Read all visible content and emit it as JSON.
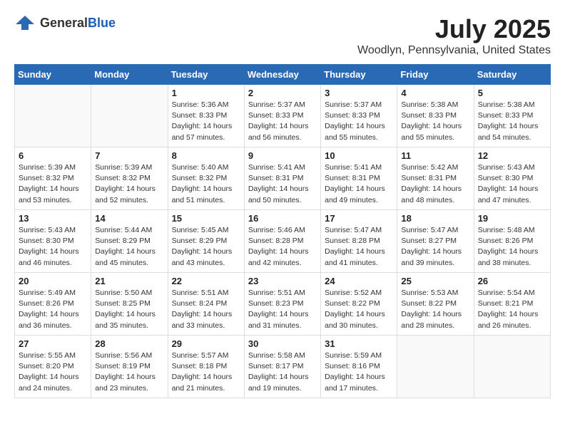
{
  "header": {
    "logo_general": "General",
    "logo_blue": "Blue",
    "month_year": "July 2025",
    "location": "Woodlyn, Pennsylvania, United States"
  },
  "days_of_week": [
    "Sunday",
    "Monday",
    "Tuesday",
    "Wednesday",
    "Thursday",
    "Friday",
    "Saturday"
  ],
  "weeks": [
    [
      {
        "day": "",
        "sunrise": "",
        "sunset": "",
        "daylight": ""
      },
      {
        "day": "",
        "sunrise": "",
        "sunset": "",
        "daylight": ""
      },
      {
        "day": "1",
        "sunrise": "Sunrise: 5:36 AM",
        "sunset": "Sunset: 8:33 PM",
        "daylight": "Daylight: 14 hours and 57 minutes."
      },
      {
        "day": "2",
        "sunrise": "Sunrise: 5:37 AM",
        "sunset": "Sunset: 8:33 PM",
        "daylight": "Daylight: 14 hours and 56 minutes."
      },
      {
        "day": "3",
        "sunrise": "Sunrise: 5:37 AM",
        "sunset": "Sunset: 8:33 PM",
        "daylight": "Daylight: 14 hours and 55 minutes."
      },
      {
        "day": "4",
        "sunrise": "Sunrise: 5:38 AM",
        "sunset": "Sunset: 8:33 PM",
        "daylight": "Daylight: 14 hours and 55 minutes."
      },
      {
        "day": "5",
        "sunrise": "Sunrise: 5:38 AM",
        "sunset": "Sunset: 8:33 PM",
        "daylight": "Daylight: 14 hours and 54 minutes."
      }
    ],
    [
      {
        "day": "6",
        "sunrise": "Sunrise: 5:39 AM",
        "sunset": "Sunset: 8:32 PM",
        "daylight": "Daylight: 14 hours and 53 minutes."
      },
      {
        "day": "7",
        "sunrise": "Sunrise: 5:39 AM",
        "sunset": "Sunset: 8:32 PM",
        "daylight": "Daylight: 14 hours and 52 minutes."
      },
      {
        "day": "8",
        "sunrise": "Sunrise: 5:40 AM",
        "sunset": "Sunset: 8:32 PM",
        "daylight": "Daylight: 14 hours and 51 minutes."
      },
      {
        "day": "9",
        "sunrise": "Sunrise: 5:41 AM",
        "sunset": "Sunset: 8:31 PM",
        "daylight": "Daylight: 14 hours and 50 minutes."
      },
      {
        "day": "10",
        "sunrise": "Sunrise: 5:41 AM",
        "sunset": "Sunset: 8:31 PM",
        "daylight": "Daylight: 14 hours and 49 minutes."
      },
      {
        "day": "11",
        "sunrise": "Sunrise: 5:42 AM",
        "sunset": "Sunset: 8:31 PM",
        "daylight": "Daylight: 14 hours and 48 minutes."
      },
      {
        "day": "12",
        "sunrise": "Sunrise: 5:43 AM",
        "sunset": "Sunset: 8:30 PM",
        "daylight": "Daylight: 14 hours and 47 minutes."
      }
    ],
    [
      {
        "day": "13",
        "sunrise": "Sunrise: 5:43 AM",
        "sunset": "Sunset: 8:30 PM",
        "daylight": "Daylight: 14 hours and 46 minutes."
      },
      {
        "day": "14",
        "sunrise": "Sunrise: 5:44 AM",
        "sunset": "Sunset: 8:29 PM",
        "daylight": "Daylight: 14 hours and 45 minutes."
      },
      {
        "day": "15",
        "sunrise": "Sunrise: 5:45 AM",
        "sunset": "Sunset: 8:29 PM",
        "daylight": "Daylight: 14 hours and 43 minutes."
      },
      {
        "day": "16",
        "sunrise": "Sunrise: 5:46 AM",
        "sunset": "Sunset: 8:28 PM",
        "daylight": "Daylight: 14 hours and 42 minutes."
      },
      {
        "day": "17",
        "sunrise": "Sunrise: 5:47 AM",
        "sunset": "Sunset: 8:28 PM",
        "daylight": "Daylight: 14 hours and 41 minutes."
      },
      {
        "day": "18",
        "sunrise": "Sunrise: 5:47 AM",
        "sunset": "Sunset: 8:27 PM",
        "daylight": "Daylight: 14 hours and 39 minutes."
      },
      {
        "day": "19",
        "sunrise": "Sunrise: 5:48 AM",
        "sunset": "Sunset: 8:26 PM",
        "daylight": "Daylight: 14 hours and 38 minutes."
      }
    ],
    [
      {
        "day": "20",
        "sunrise": "Sunrise: 5:49 AM",
        "sunset": "Sunset: 8:26 PM",
        "daylight": "Daylight: 14 hours and 36 minutes."
      },
      {
        "day": "21",
        "sunrise": "Sunrise: 5:50 AM",
        "sunset": "Sunset: 8:25 PM",
        "daylight": "Daylight: 14 hours and 35 minutes."
      },
      {
        "day": "22",
        "sunrise": "Sunrise: 5:51 AM",
        "sunset": "Sunset: 8:24 PM",
        "daylight": "Daylight: 14 hours and 33 minutes."
      },
      {
        "day": "23",
        "sunrise": "Sunrise: 5:51 AM",
        "sunset": "Sunset: 8:23 PM",
        "daylight": "Daylight: 14 hours and 31 minutes."
      },
      {
        "day": "24",
        "sunrise": "Sunrise: 5:52 AM",
        "sunset": "Sunset: 8:22 PM",
        "daylight": "Daylight: 14 hours and 30 minutes."
      },
      {
        "day": "25",
        "sunrise": "Sunrise: 5:53 AM",
        "sunset": "Sunset: 8:22 PM",
        "daylight": "Daylight: 14 hours and 28 minutes."
      },
      {
        "day": "26",
        "sunrise": "Sunrise: 5:54 AM",
        "sunset": "Sunset: 8:21 PM",
        "daylight": "Daylight: 14 hours and 26 minutes."
      }
    ],
    [
      {
        "day": "27",
        "sunrise": "Sunrise: 5:55 AM",
        "sunset": "Sunset: 8:20 PM",
        "daylight": "Daylight: 14 hours and 24 minutes."
      },
      {
        "day": "28",
        "sunrise": "Sunrise: 5:56 AM",
        "sunset": "Sunset: 8:19 PM",
        "daylight": "Daylight: 14 hours and 23 minutes."
      },
      {
        "day": "29",
        "sunrise": "Sunrise: 5:57 AM",
        "sunset": "Sunset: 8:18 PM",
        "daylight": "Daylight: 14 hours and 21 minutes."
      },
      {
        "day": "30",
        "sunrise": "Sunrise: 5:58 AM",
        "sunset": "Sunset: 8:17 PM",
        "daylight": "Daylight: 14 hours and 19 minutes."
      },
      {
        "day": "31",
        "sunrise": "Sunrise: 5:59 AM",
        "sunset": "Sunset: 8:16 PM",
        "daylight": "Daylight: 14 hours and 17 minutes."
      },
      {
        "day": "",
        "sunrise": "",
        "sunset": "",
        "daylight": ""
      },
      {
        "day": "",
        "sunrise": "",
        "sunset": "",
        "daylight": ""
      }
    ]
  ]
}
